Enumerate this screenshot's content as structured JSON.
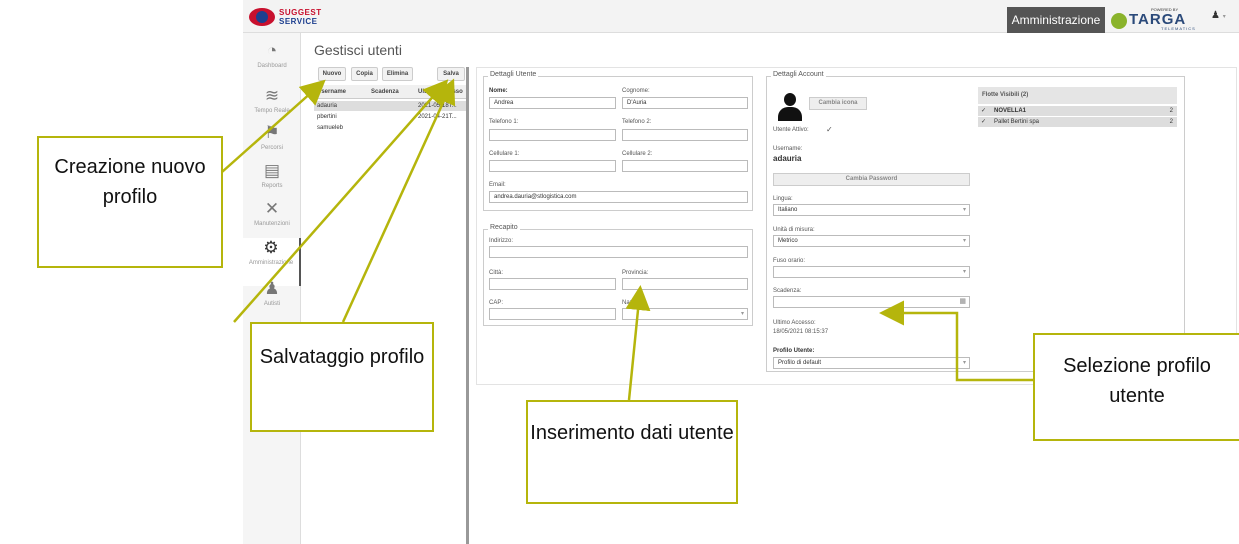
{
  "header": {
    "logo_line1": "SUGGEST",
    "logo_line2": "SERVICE",
    "admin_tab": "Amministrazione",
    "targa_powered": "POWERED BY",
    "targa_name": "TARGA",
    "targa_sub": "TELEMATICS",
    "user_caret": "▾"
  },
  "sidebar": {
    "items": [
      {
        "label": "Dashboard",
        "icon": "dashboard-icon",
        "glyph": "◔"
      },
      {
        "label": "Tempo Reale",
        "icon": "wifi-icon",
        "glyph": "≋"
      },
      {
        "label": "Percorsi",
        "icon": "route-icon",
        "glyph": "⚑"
      },
      {
        "label": "Reports",
        "icon": "report-icon",
        "glyph": "▤"
      },
      {
        "label": "Manutenzioni",
        "icon": "tools-icon",
        "glyph": "✕"
      },
      {
        "label": "Amministrazione",
        "icon": "gears-icon",
        "glyph": "⚙"
      },
      {
        "label": "Autisti",
        "icon": "drivers-icon",
        "glyph": "♟"
      }
    ]
  },
  "page": {
    "title": "Gestisci utenti"
  },
  "list": {
    "toolbar": {
      "new": "Nuovo",
      "copy": "Copia",
      "delete": "Elimina",
      "save": "Salva"
    },
    "columns": [
      "Username",
      "Scadenza",
      "Ultimo Accesso"
    ],
    "rows": [
      {
        "username": "adauria",
        "last": "2021-05-18T..."
      },
      {
        "username": "pbertini",
        "last": "2021-04-21T..."
      },
      {
        "username": "samueleb",
        "last": ""
      }
    ]
  },
  "user_details": {
    "legend": "Dettagli Utente",
    "nome_label": "Nome:",
    "nome_value": "Andrea",
    "cognome_label": "Cognome:",
    "cognome_value": "D'Auria",
    "tel1_label": "Telefono 1:",
    "tel2_label": "Telefono 2:",
    "cell1_label": "Cellulare 1:",
    "cell2_label": "Cellulare 2:",
    "email_label": "Email:",
    "email_value": "andrea.dauria@stlogistica.com"
  },
  "recapito": {
    "legend": "Recapito",
    "indirizzo_label": "Indirizzo:",
    "citta_label": "Città:",
    "provincia_label": "Provincia:",
    "cap_label": "CAP:",
    "nazione_label": "Nazione:"
  },
  "account": {
    "legend": "Dettagli Account",
    "change_icon": "Cambia icona",
    "active_label": "Utente Attivo:",
    "active_check": "✓",
    "username_label": "Username:",
    "username_value": "adauria",
    "change_password": "Cambia Password",
    "lingua_label": "Lingua:",
    "lingua_value": "Italiano",
    "unita_label": "Unità di misura:",
    "unita_value": "Metrico",
    "fuso_label": "Fuso orario:",
    "fuso_value": "",
    "scadenza_label": "Scadenza:",
    "ultimo_label": "Ultimo Accesso:",
    "ultimo_value": "18/05/2021 08:15:37",
    "profilo_label": "Profilo Utente:",
    "profilo_value": "Profilo di default"
  },
  "flotte": {
    "header": "Flotte Visibili (2)",
    "items": [
      {
        "name": "NOVELLA1",
        "count": "2",
        "check": "✓"
      },
      {
        "name": "Pallet Bertini spa",
        "count": "2",
        "check": "✓"
      }
    ]
  },
  "annotations": {
    "creazione": "Creazione nuovo profilo",
    "salvataggio": "Salvataggio profilo",
    "inserimento": "Inserimento dati utente",
    "selezione": "Selezione profilo utente"
  },
  "colors": {
    "accent": "#b5b50c",
    "admin_tab": "#555555",
    "targa_green": "#8ab32b"
  }
}
